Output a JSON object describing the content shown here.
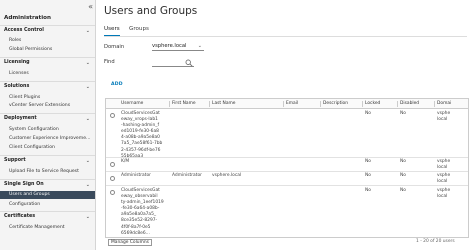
{
  "sidebar": {
    "collapse_glyph": "«",
    "title": "Administration",
    "sections": [
      {
        "label": "Access Control",
        "items": [
          "Roles",
          "Global Permissions"
        ]
      },
      {
        "label": "Licensing",
        "items": [
          "Licenses"
        ]
      },
      {
        "label": "Solutions",
        "items": [
          "Client Plugins",
          "vCenter Server Extensions"
        ]
      },
      {
        "label": "Deployment",
        "items": [
          "System Configuration",
          "Customer Experience Improveme...",
          "Client Configuration"
        ]
      },
      {
        "label": "Support",
        "items": [
          "Upload File to Service Request"
        ]
      },
      {
        "label": "Single Sign On",
        "items": [
          "Users and Groups",
          "Configuration"
        ]
      },
      {
        "label": "Certificates",
        "items": [
          "Certificate Management"
        ]
      }
    ],
    "active_item": "Users and Groups"
  },
  "main": {
    "title": "Users and Groups",
    "tabs": [
      {
        "label": "Users",
        "active": true
      },
      {
        "label": "Groups",
        "active": false
      }
    ],
    "domain_label": "Domain",
    "domain_value": "vsphere.local",
    "find_label": "Find",
    "find_value": "",
    "add_label": "ADD"
  },
  "grid": {
    "columns": [
      "Username",
      "First Name",
      "Last Name",
      "Email",
      "Description",
      "Locked",
      "Disabled",
      "Domai"
    ],
    "rows": [
      {
        "username": "CloudServicesGat\neway_vrops-lab1\n-hashing-admin_f\ned1019-fe30-6a8\n4-a08b-a9a5e8a0\n7a5_7ae58f61-7bb\n2-4357-96df-be76\n55b65aa3",
        "first_name": "",
        "last_name": "",
        "email": "",
        "description": "",
        "locked": "No",
        "disabled": "No",
        "domain": "vsphe\nlocal"
      },
      {
        "username": "K/M",
        "first_name": "",
        "last_name": "",
        "email": "",
        "description": "",
        "locked": "No",
        "disabled": "No",
        "domain": "vsphe\nlocal"
      },
      {
        "username": "Administrator",
        "first_name": "Administrator",
        "last_name": "vsphere.local",
        "email": "",
        "description": "",
        "locked": "No",
        "disabled": "No",
        "domain": "vsphe\nlocal"
      },
      {
        "username": "CloudServicesGat\neway_observabil\nty-admin_1eef1019\n-fe30-6a64-a08b-\na9a5e8a0a7a5_\n8ce35e52-8297-\n4f0f-8a7f-0e5\n6569dc8e6...",
        "first_name": "",
        "last_name": "",
        "email": "",
        "description": "",
        "locked": "No",
        "disabled": "No",
        "domain": "vsphe\nlocal"
      }
    ],
    "manage_columns_label": "Manage Columns",
    "pager_text": "1 - 20 of 20 users"
  },
  "colors": {
    "accent": "#0079b8",
    "sidebar_bg": "#f4f4f4",
    "active_bg": "#3a4a5c"
  }
}
